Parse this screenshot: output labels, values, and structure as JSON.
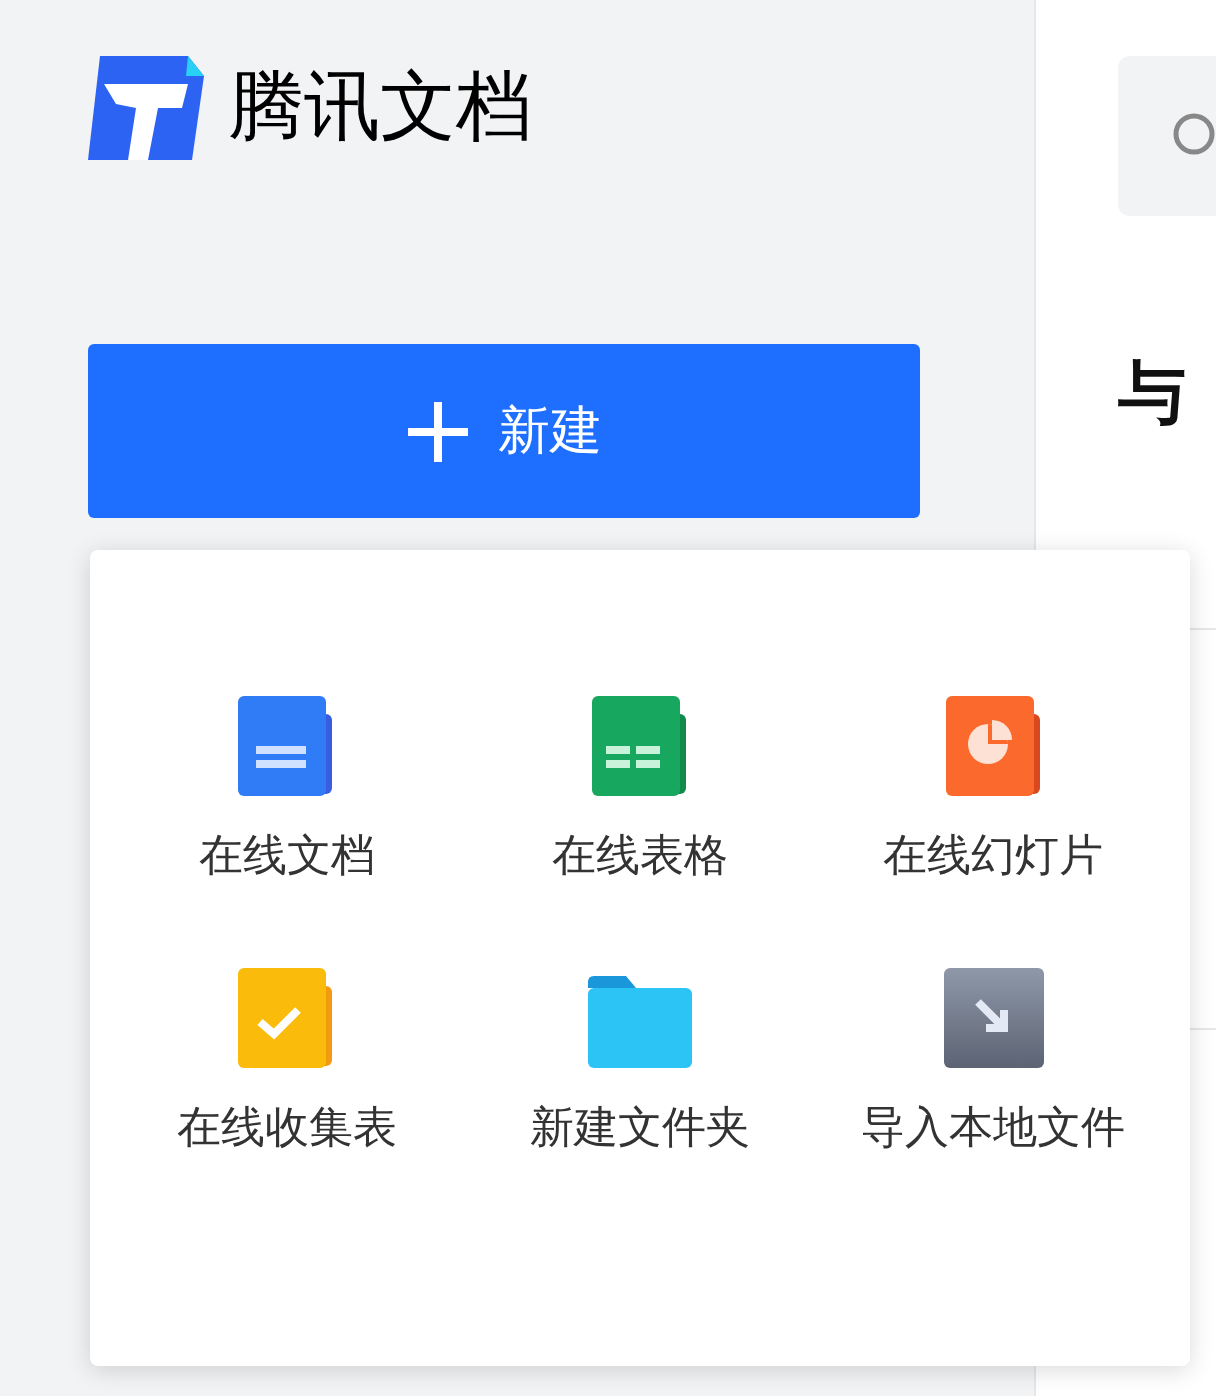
{
  "brand": {
    "name": "腾讯文档"
  },
  "new_button": {
    "label": "新建"
  },
  "main": {
    "heading": "与"
  },
  "create_menu": {
    "items": [
      {
        "kind": "doc",
        "label": "在线文档"
      },
      {
        "kind": "sheet",
        "label": "在线表格"
      },
      {
        "kind": "slide",
        "label": "在线幻灯片"
      },
      {
        "kind": "form",
        "label": "在线收集表"
      },
      {
        "kind": "folder",
        "label": "新建文件夹"
      },
      {
        "kind": "import",
        "label": "导入本地文件"
      }
    ]
  }
}
